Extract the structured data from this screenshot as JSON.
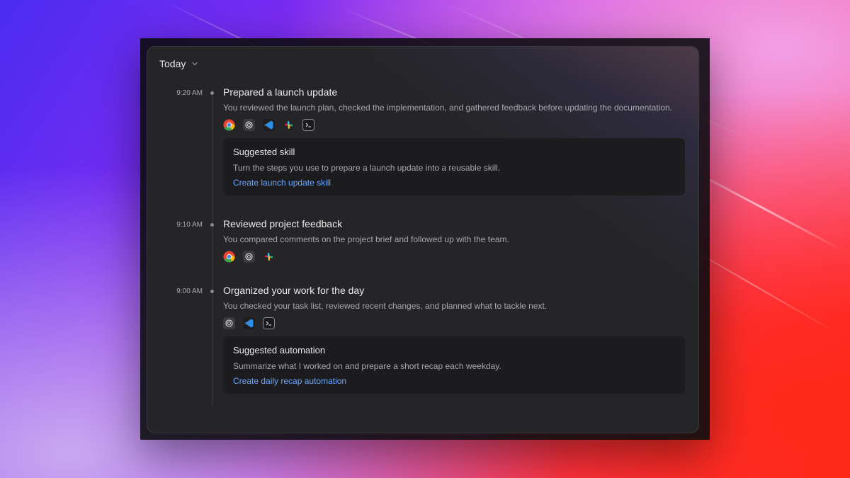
{
  "panel": {
    "header": {
      "label": "Today"
    },
    "entries": [
      {
        "time": "9:20 AM",
        "title": "Prepared a launch update",
        "description": "You reviewed the launch plan, checked the implementation, and gathered feedback before updating the documentation.",
        "apps": [
          "chrome-icon",
          "settings-app-icon",
          "vscode-icon",
          "slack-icon",
          "terminal-icon"
        ],
        "suggestion": {
          "title": "Suggested skill",
          "description": "Turn the steps you use to prepare a launch update into a reusable skill.",
          "action": "Create launch update skill"
        }
      },
      {
        "time": "9:10 AM",
        "title": "Reviewed project feedback",
        "description": "You compared comments on the project brief and followed up with the team.",
        "apps": [
          "chrome-icon",
          "settings-app-icon",
          "slack-icon"
        ]
      },
      {
        "time": "9:00 AM",
        "title": "Organized your work for the day",
        "description": "You checked your task list, reviewed recent changes, and planned what to tackle next.",
        "apps": [
          "settings-app-icon",
          "vscode-icon",
          "terminal-icon"
        ],
        "suggestion": {
          "title": "Suggested automation",
          "description": "Summarize what I worked on and prepare a short recap each weekday.",
          "action": "Create daily recap automation"
        }
      }
    ]
  },
  "colors": {
    "panel_bg": "#252527",
    "card_bg": "#1c1c1e",
    "link": "#6aa6ff",
    "text_primary": "#ececee",
    "text_secondary": "#a8a8ae"
  }
}
